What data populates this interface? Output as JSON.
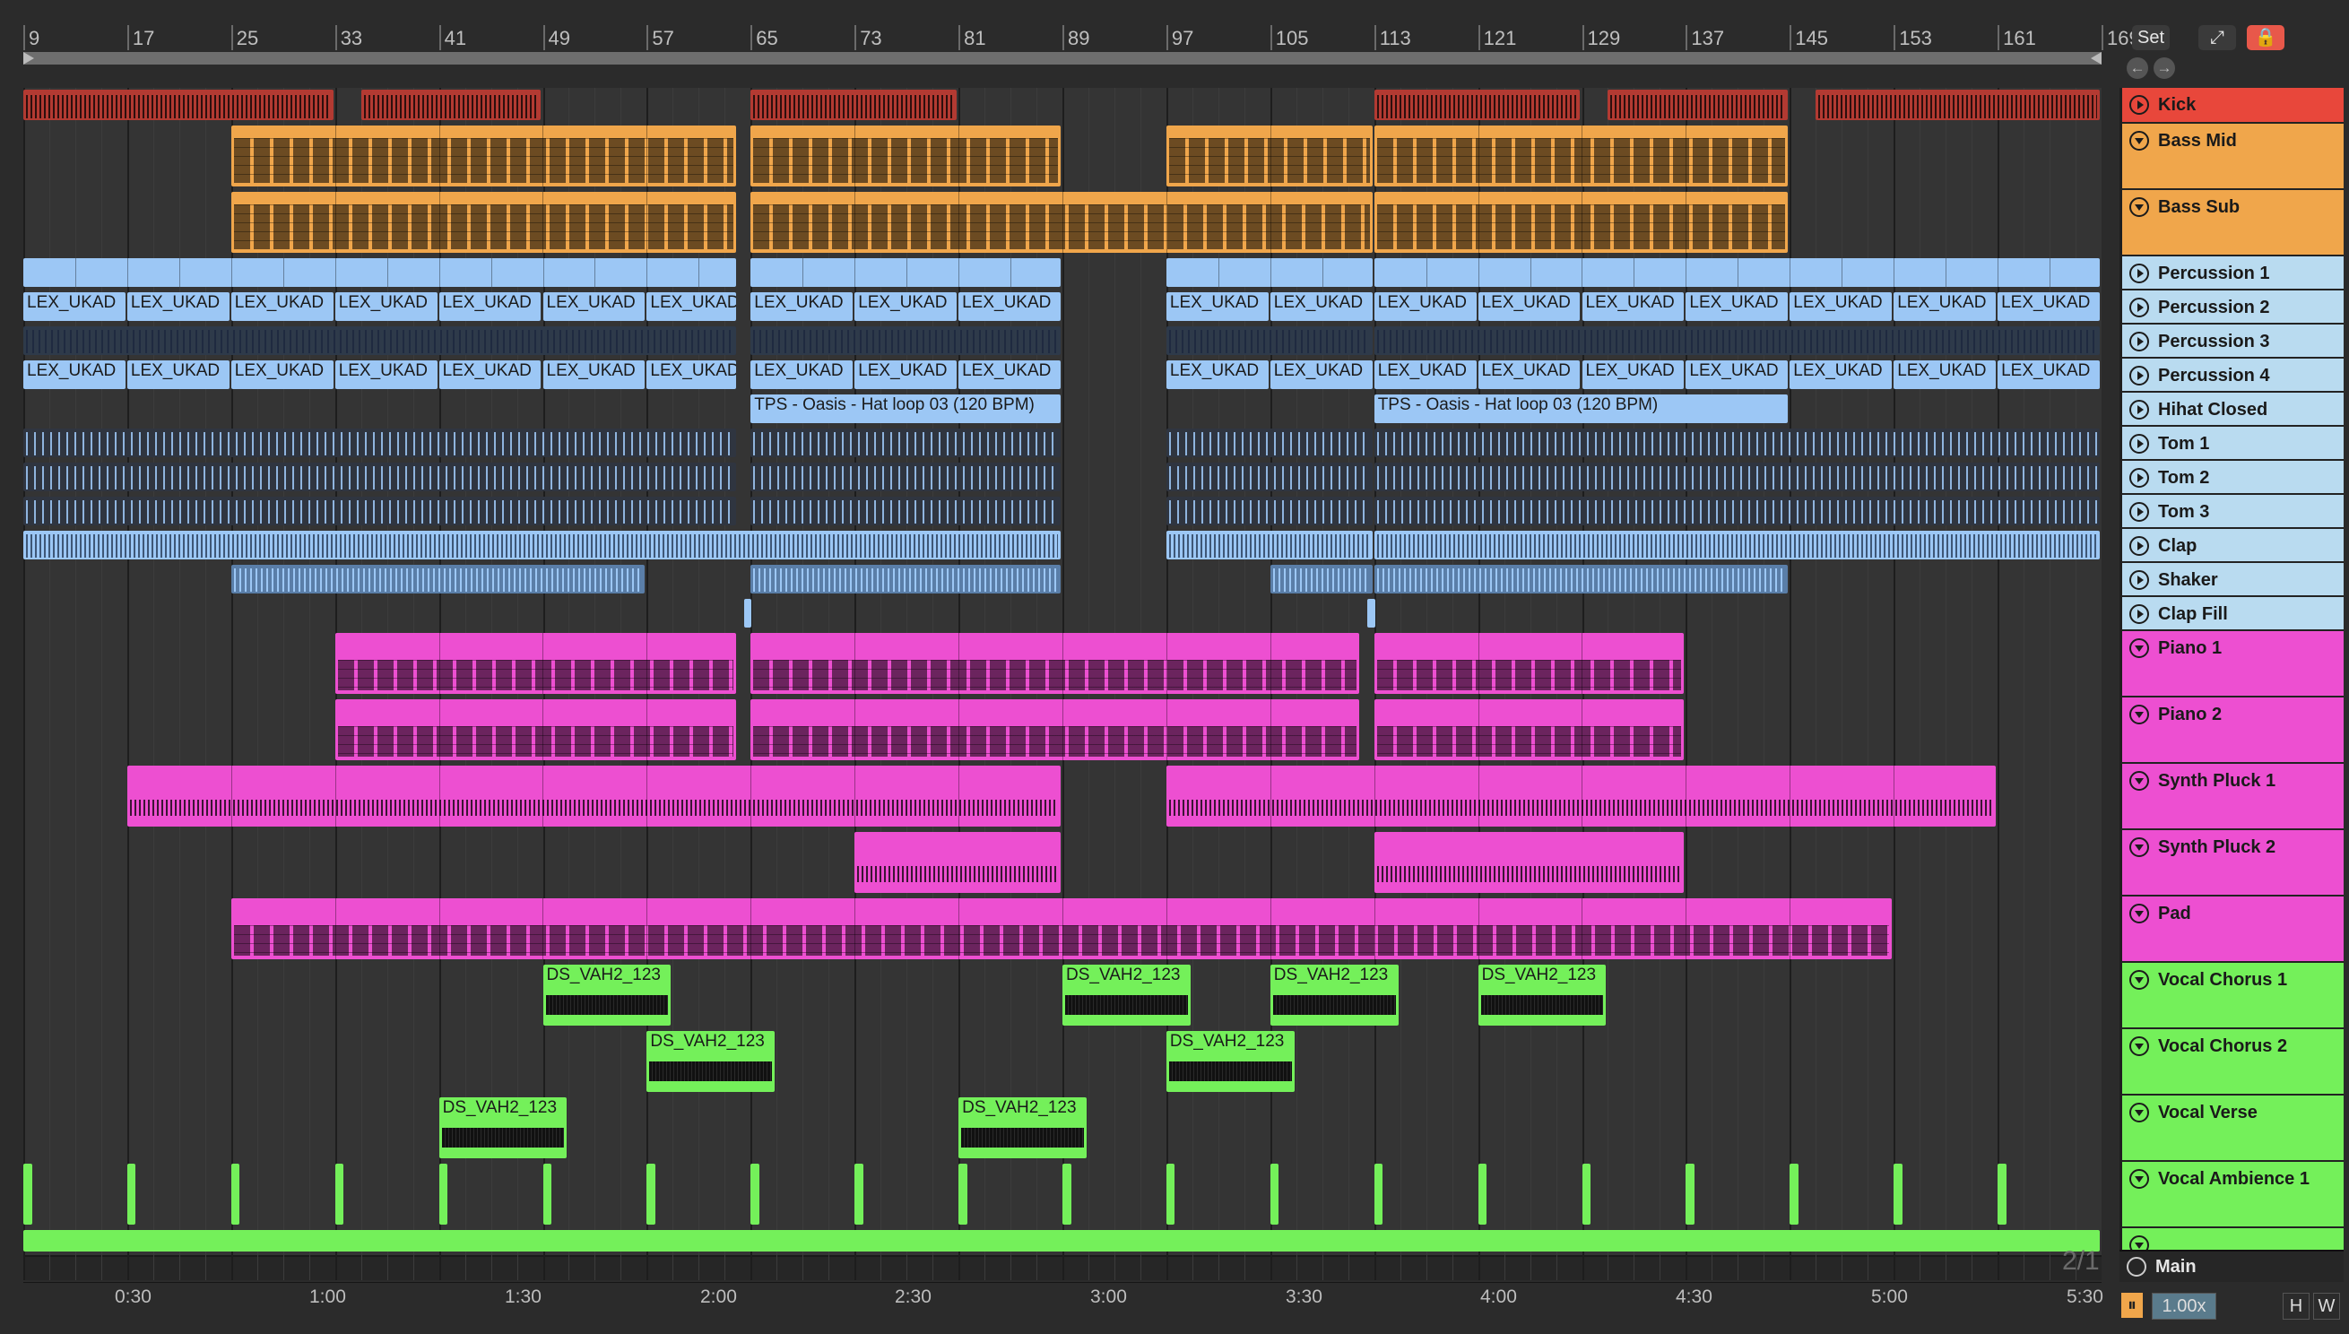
{
  "window": {
    "set_label": "Set",
    "zoom_label": "1.00x",
    "page_indicator": "2/1",
    "h_label": "H",
    "w_label": "W"
  },
  "ruler": {
    "bars": [
      "9",
      "17",
      "25",
      "33",
      "41",
      "49",
      "57",
      "65",
      "73",
      "81",
      "89",
      "97",
      "105",
      "113",
      "121",
      "129",
      "137",
      "145",
      "153",
      "161",
      "169"
    ]
  },
  "timebar": {
    "labels": [
      "0:30",
      "1:00",
      "1:30",
      "2:00",
      "2:30",
      "3:00",
      "3:30",
      "4:00",
      "4:30",
      "5:00",
      "5:30"
    ]
  },
  "colors": {
    "red": "#e8473b",
    "orange": "#f0a64b",
    "blue": "#9cc7f5",
    "blue_header": "#b9dbf0",
    "pink": "#ed4fd1",
    "green": "#74f05a",
    "clip_text": "#1a1a1a"
  },
  "tracks": [
    {
      "name": "Kick",
      "state": "closed",
      "color": "#e8473b"
    },
    {
      "name": "Bass Mid",
      "state": "open",
      "color": "#f0a64b"
    },
    {
      "name": "Bass Sub",
      "state": "open",
      "color": "#f0a64b"
    },
    {
      "name": "Percussion 1",
      "state": "closed",
      "color": "#b9dbf0"
    },
    {
      "name": "Percussion 2",
      "state": "closed",
      "color": "#b9dbf0"
    },
    {
      "name": "Percussion 3",
      "state": "closed",
      "color": "#b9dbf0"
    },
    {
      "name": "Percussion 4",
      "state": "closed",
      "color": "#b9dbf0"
    },
    {
      "name": "Hihat Closed",
      "state": "closed",
      "color": "#b9dbf0"
    },
    {
      "name": "Tom 1",
      "state": "closed",
      "color": "#b9dbf0"
    },
    {
      "name": "Tom 2",
      "state": "closed",
      "color": "#b9dbf0"
    },
    {
      "name": "Tom 3",
      "state": "closed",
      "color": "#b9dbf0"
    },
    {
      "name": "Clap",
      "state": "closed",
      "color": "#b9dbf0"
    },
    {
      "name": "Shaker",
      "state": "closed",
      "color": "#b9dbf0"
    },
    {
      "name": "Clap Fill",
      "state": "closed",
      "color": "#b9dbf0"
    },
    {
      "name": "Piano 1",
      "state": "open",
      "color": "#ed4fd1"
    },
    {
      "name": "Piano 2",
      "state": "open",
      "color": "#ed4fd1"
    },
    {
      "name": "Synth Pluck 1",
      "state": "open",
      "color": "#ed4fd1"
    },
    {
      "name": "Synth Pluck 2",
      "state": "open",
      "color": "#ed4fd1"
    },
    {
      "name": "Pad",
      "state": "open",
      "color": "#ed4fd1"
    },
    {
      "name": "Vocal Chorus 1",
      "state": "open",
      "color": "#74f05a"
    },
    {
      "name": "Vocal Chorus 2",
      "state": "open",
      "color": "#74f05a"
    },
    {
      "name": "Vocal Verse",
      "state": "open",
      "color": "#74f05a"
    },
    {
      "name": "Vocal Ambience 1",
      "state": "open",
      "color": "#74f05a"
    },
    {
      "name": "",
      "state": "open",
      "color": "#74f05a"
    }
  ],
  "main_track": {
    "name": "Main"
  },
  "clip_labels": {
    "lex": "LEX_UKAD",
    "hat": "TPS - Oasis - Hat loop 03 (120 BPM)",
    "vox": "DS_VAH2_123"
  }
}
